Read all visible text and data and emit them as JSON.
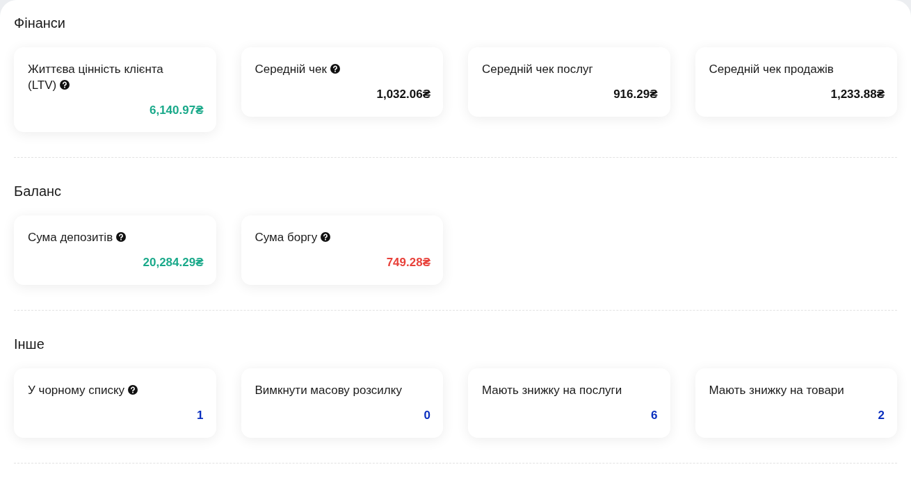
{
  "sections": [
    {
      "title": "Фінанси",
      "cards": [
        {
          "label": "Життєва цінність клієнта (LTV)",
          "help": true,
          "value": "6,140.97₴",
          "color": "#1aa98a"
        },
        {
          "label": "Середній чек",
          "help": true,
          "value": "1,032.06₴",
          "color": "#111111"
        },
        {
          "label": "Середній чек послуг",
          "help": false,
          "value": "916.29₴",
          "color": "#111111"
        },
        {
          "label": "Середній чек продажів",
          "help": false,
          "value": "1,233.88₴",
          "color": "#111111"
        }
      ]
    },
    {
      "title": "Баланс",
      "cards": [
        {
          "label": "Сума депозитів",
          "help": true,
          "value": "20,284.29₴",
          "color": "#1aa98a"
        },
        {
          "label": "Сума боргу",
          "help": true,
          "value": "749.28₴",
          "color": "#e8413a"
        }
      ]
    },
    {
      "title": "Інше",
      "cards": [
        {
          "label": "У чорному списку",
          "help": true,
          "value": "1",
          "color": "#0a2fbf"
        },
        {
          "label": "Вимкнути масову розсилку",
          "help": false,
          "value": "0",
          "color": "#0a2fbf"
        },
        {
          "label": "Мають знижку на послуги",
          "help": false,
          "value": "6",
          "color": "#0a2fbf"
        },
        {
          "label": "Мають знижку на товари",
          "help": false,
          "value": "2",
          "color": "#0a2fbf"
        }
      ]
    }
  ]
}
